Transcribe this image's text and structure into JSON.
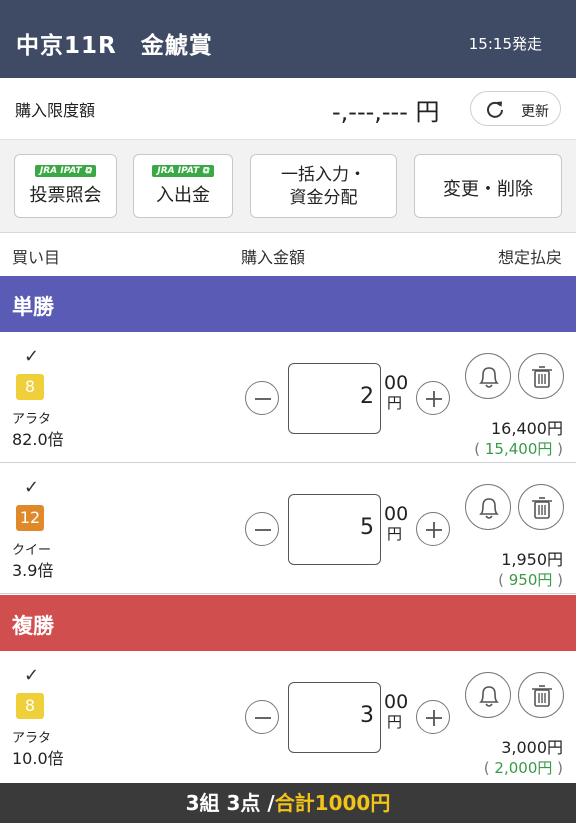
{
  "header": {
    "title": "中京11R　金鯱賞",
    "post_time": "15:15発走"
  },
  "limit": {
    "label": "購入限度額",
    "amount": "-,---,--- 円",
    "refresh_label": "更新"
  },
  "actions": {
    "badge": "JRA IPAT ⧉",
    "inquiry": "投票照会",
    "deposit": "入出金",
    "bulk_line1": "一括入力・",
    "bulk_line2": "資金分配",
    "edit": "変更・削除"
  },
  "columns": {
    "bet": "買い目",
    "amount": "購入金額",
    "payout": "想定払戻"
  },
  "sections": {
    "win": "単勝",
    "place": "複勝"
  },
  "colors": {
    "header": "#3f4a64",
    "win": "#5a5bb5",
    "place": "#d04e4e",
    "profit": "#3a9a4a",
    "num8": "#efcf3a",
    "num12": "#e0892a"
  },
  "bets": [
    {
      "check": "✓",
      "number": "8",
      "name": "アラタ",
      "odds": "82.0倍",
      "units": "2",
      "unit_suffix": "00",
      "yen": "円",
      "payout": "16,400円",
      "profit_open": "( ",
      "profit": "15,400円",
      "profit_close": " )"
    },
    {
      "check": "✓",
      "number": "12",
      "name": "クイー",
      "odds": "3.9倍",
      "units": "5",
      "unit_suffix": "00",
      "yen": "円",
      "payout": "1,950円",
      "profit_open": "( ",
      "profit": "950円",
      "profit_close": " )"
    },
    {
      "check": "✓",
      "number": "8",
      "name": "アラタ",
      "odds": "10.0倍",
      "units": "3",
      "unit_suffix": "00",
      "yen": "円",
      "payout": "3,000円",
      "profit_open": "( ",
      "profit": "2,000円",
      "profit_close": " )"
    }
  ],
  "footer": {
    "summary": "3組 3点 /",
    "total": "合計1000円"
  }
}
